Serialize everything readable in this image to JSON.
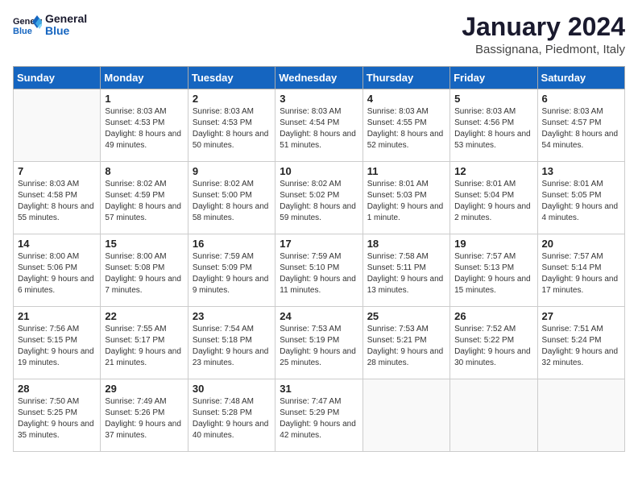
{
  "logo": {
    "text_general": "General",
    "text_blue": "Blue"
  },
  "header": {
    "month": "January 2024",
    "location": "Bassignana, Piedmont, Italy"
  },
  "weekdays": [
    "Sunday",
    "Monday",
    "Tuesday",
    "Wednesday",
    "Thursday",
    "Friday",
    "Saturday"
  ],
  "weeks": [
    [
      {
        "day": "",
        "sunrise": "",
        "sunset": "",
        "daylight": "",
        "empty": true
      },
      {
        "day": "1",
        "sunrise": "Sunrise: 8:03 AM",
        "sunset": "Sunset: 4:53 PM",
        "daylight": "Daylight: 8 hours and 49 minutes."
      },
      {
        "day": "2",
        "sunrise": "Sunrise: 8:03 AM",
        "sunset": "Sunset: 4:53 PM",
        "daylight": "Daylight: 8 hours and 50 minutes."
      },
      {
        "day": "3",
        "sunrise": "Sunrise: 8:03 AM",
        "sunset": "Sunset: 4:54 PM",
        "daylight": "Daylight: 8 hours and 51 minutes."
      },
      {
        "day": "4",
        "sunrise": "Sunrise: 8:03 AM",
        "sunset": "Sunset: 4:55 PM",
        "daylight": "Daylight: 8 hours and 52 minutes."
      },
      {
        "day": "5",
        "sunrise": "Sunrise: 8:03 AM",
        "sunset": "Sunset: 4:56 PM",
        "daylight": "Daylight: 8 hours and 53 minutes."
      },
      {
        "day": "6",
        "sunrise": "Sunrise: 8:03 AM",
        "sunset": "Sunset: 4:57 PM",
        "daylight": "Daylight: 8 hours and 54 minutes."
      }
    ],
    [
      {
        "day": "7",
        "sunrise": "Sunrise: 8:03 AM",
        "sunset": "Sunset: 4:58 PM",
        "daylight": "Daylight: 8 hours and 55 minutes."
      },
      {
        "day": "8",
        "sunrise": "Sunrise: 8:02 AM",
        "sunset": "Sunset: 4:59 PM",
        "daylight": "Daylight: 8 hours and 57 minutes."
      },
      {
        "day": "9",
        "sunrise": "Sunrise: 8:02 AM",
        "sunset": "Sunset: 5:00 PM",
        "daylight": "Daylight: 8 hours and 58 minutes."
      },
      {
        "day": "10",
        "sunrise": "Sunrise: 8:02 AM",
        "sunset": "Sunset: 5:02 PM",
        "daylight": "Daylight: 8 hours and 59 minutes."
      },
      {
        "day": "11",
        "sunrise": "Sunrise: 8:01 AM",
        "sunset": "Sunset: 5:03 PM",
        "daylight": "Daylight: 9 hours and 1 minute."
      },
      {
        "day": "12",
        "sunrise": "Sunrise: 8:01 AM",
        "sunset": "Sunset: 5:04 PM",
        "daylight": "Daylight: 9 hours and 2 minutes."
      },
      {
        "day": "13",
        "sunrise": "Sunrise: 8:01 AM",
        "sunset": "Sunset: 5:05 PM",
        "daylight": "Daylight: 9 hours and 4 minutes."
      }
    ],
    [
      {
        "day": "14",
        "sunrise": "Sunrise: 8:00 AM",
        "sunset": "Sunset: 5:06 PM",
        "daylight": "Daylight: 9 hours and 6 minutes."
      },
      {
        "day": "15",
        "sunrise": "Sunrise: 8:00 AM",
        "sunset": "Sunset: 5:08 PM",
        "daylight": "Daylight: 9 hours and 7 minutes."
      },
      {
        "day": "16",
        "sunrise": "Sunrise: 7:59 AM",
        "sunset": "Sunset: 5:09 PM",
        "daylight": "Daylight: 9 hours and 9 minutes."
      },
      {
        "day": "17",
        "sunrise": "Sunrise: 7:59 AM",
        "sunset": "Sunset: 5:10 PM",
        "daylight": "Daylight: 9 hours and 11 minutes."
      },
      {
        "day": "18",
        "sunrise": "Sunrise: 7:58 AM",
        "sunset": "Sunset: 5:11 PM",
        "daylight": "Daylight: 9 hours and 13 minutes."
      },
      {
        "day": "19",
        "sunrise": "Sunrise: 7:57 AM",
        "sunset": "Sunset: 5:13 PM",
        "daylight": "Daylight: 9 hours and 15 minutes."
      },
      {
        "day": "20",
        "sunrise": "Sunrise: 7:57 AM",
        "sunset": "Sunset: 5:14 PM",
        "daylight": "Daylight: 9 hours and 17 minutes."
      }
    ],
    [
      {
        "day": "21",
        "sunrise": "Sunrise: 7:56 AM",
        "sunset": "Sunset: 5:15 PM",
        "daylight": "Daylight: 9 hours and 19 minutes."
      },
      {
        "day": "22",
        "sunrise": "Sunrise: 7:55 AM",
        "sunset": "Sunset: 5:17 PM",
        "daylight": "Daylight: 9 hours and 21 minutes."
      },
      {
        "day": "23",
        "sunrise": "Sunrise: 7:54 AM",
        "sunset": "Sunset: 5:18 PM",
        "daylight": "Daylight: 9 hours and 23 minutes."
      },
      {
        "day": "24",
        "sunrise": "Sunrise: 7:53 AM",
        "sunset": "Sunset: 5:19 PM",
        "daylight": "Daylight: 9 hours and 25 minutes."
      },
      {
        "day": "25",
        "sunrise": "Sunrise: 7:53 AM",
        "sunset": "Sunset: 5:21 PM",
        "daylight": "Daylight: 9 hours and 28 minutes."
      },
      {
        "day": "26",
        "sunrise": "Sunrise: 7:52 AM",
        "sunset": "Sunset: 5:22 PM",
        "daylight": "Daylight: 9 hours and 30 minutes."
      },
      {
        "day": "27",
        "sunrise": "Sunrise: 7:51 AM",
        "sunset": "Sunset: 5:24 PM",
        "daylight": "Daylight: 9 hours and 32 minutes."
      }
    ],
    [
      {
        "day": "28",
        "sunrise": "Sunrise: 7:50 AM",
        "sunset": "Sunset: 5:25 PM",
        "daylight": "Daylight: 9 hours and 35 minutes."
      },
      {
        "day": "29",
        "sunrise": "Sunrise: 7:49 AM",
        "sunset": "Sunset: 5:26 PM",
        "daylight": "Daylight: 9 hours and 37 minutes."
      },
      {
        "day": "30",
        "sunrise": "Sunrise: 7:48 AM",
        "sunset": "Sunset: 5:28 PM",
        "daylight": "Daylight: 9 hours and 40 minutes."
      },
      {
        "day": "31",
        "sunrise": "Sunrise: 7:47 AM",
        "sunset": "Sunset: 5:29 PM",
        "daylight": "Daylight: 9 hours and 42 minutes."
      },
      {
        "day": "",
        "sunrise": "",
        "sunset": "",
        "daylight": "",
        "empty": true
      },
      {
        "day": "",
        "sunrise": "",
        "sunset": "",
        "daylight": "",
        "empty": true
      },
      {
        "day": "",
        "sunrise": "",
        "sunset": "",
        "daylight": "",
        "empty": true
      }
    ]
  ]
}
